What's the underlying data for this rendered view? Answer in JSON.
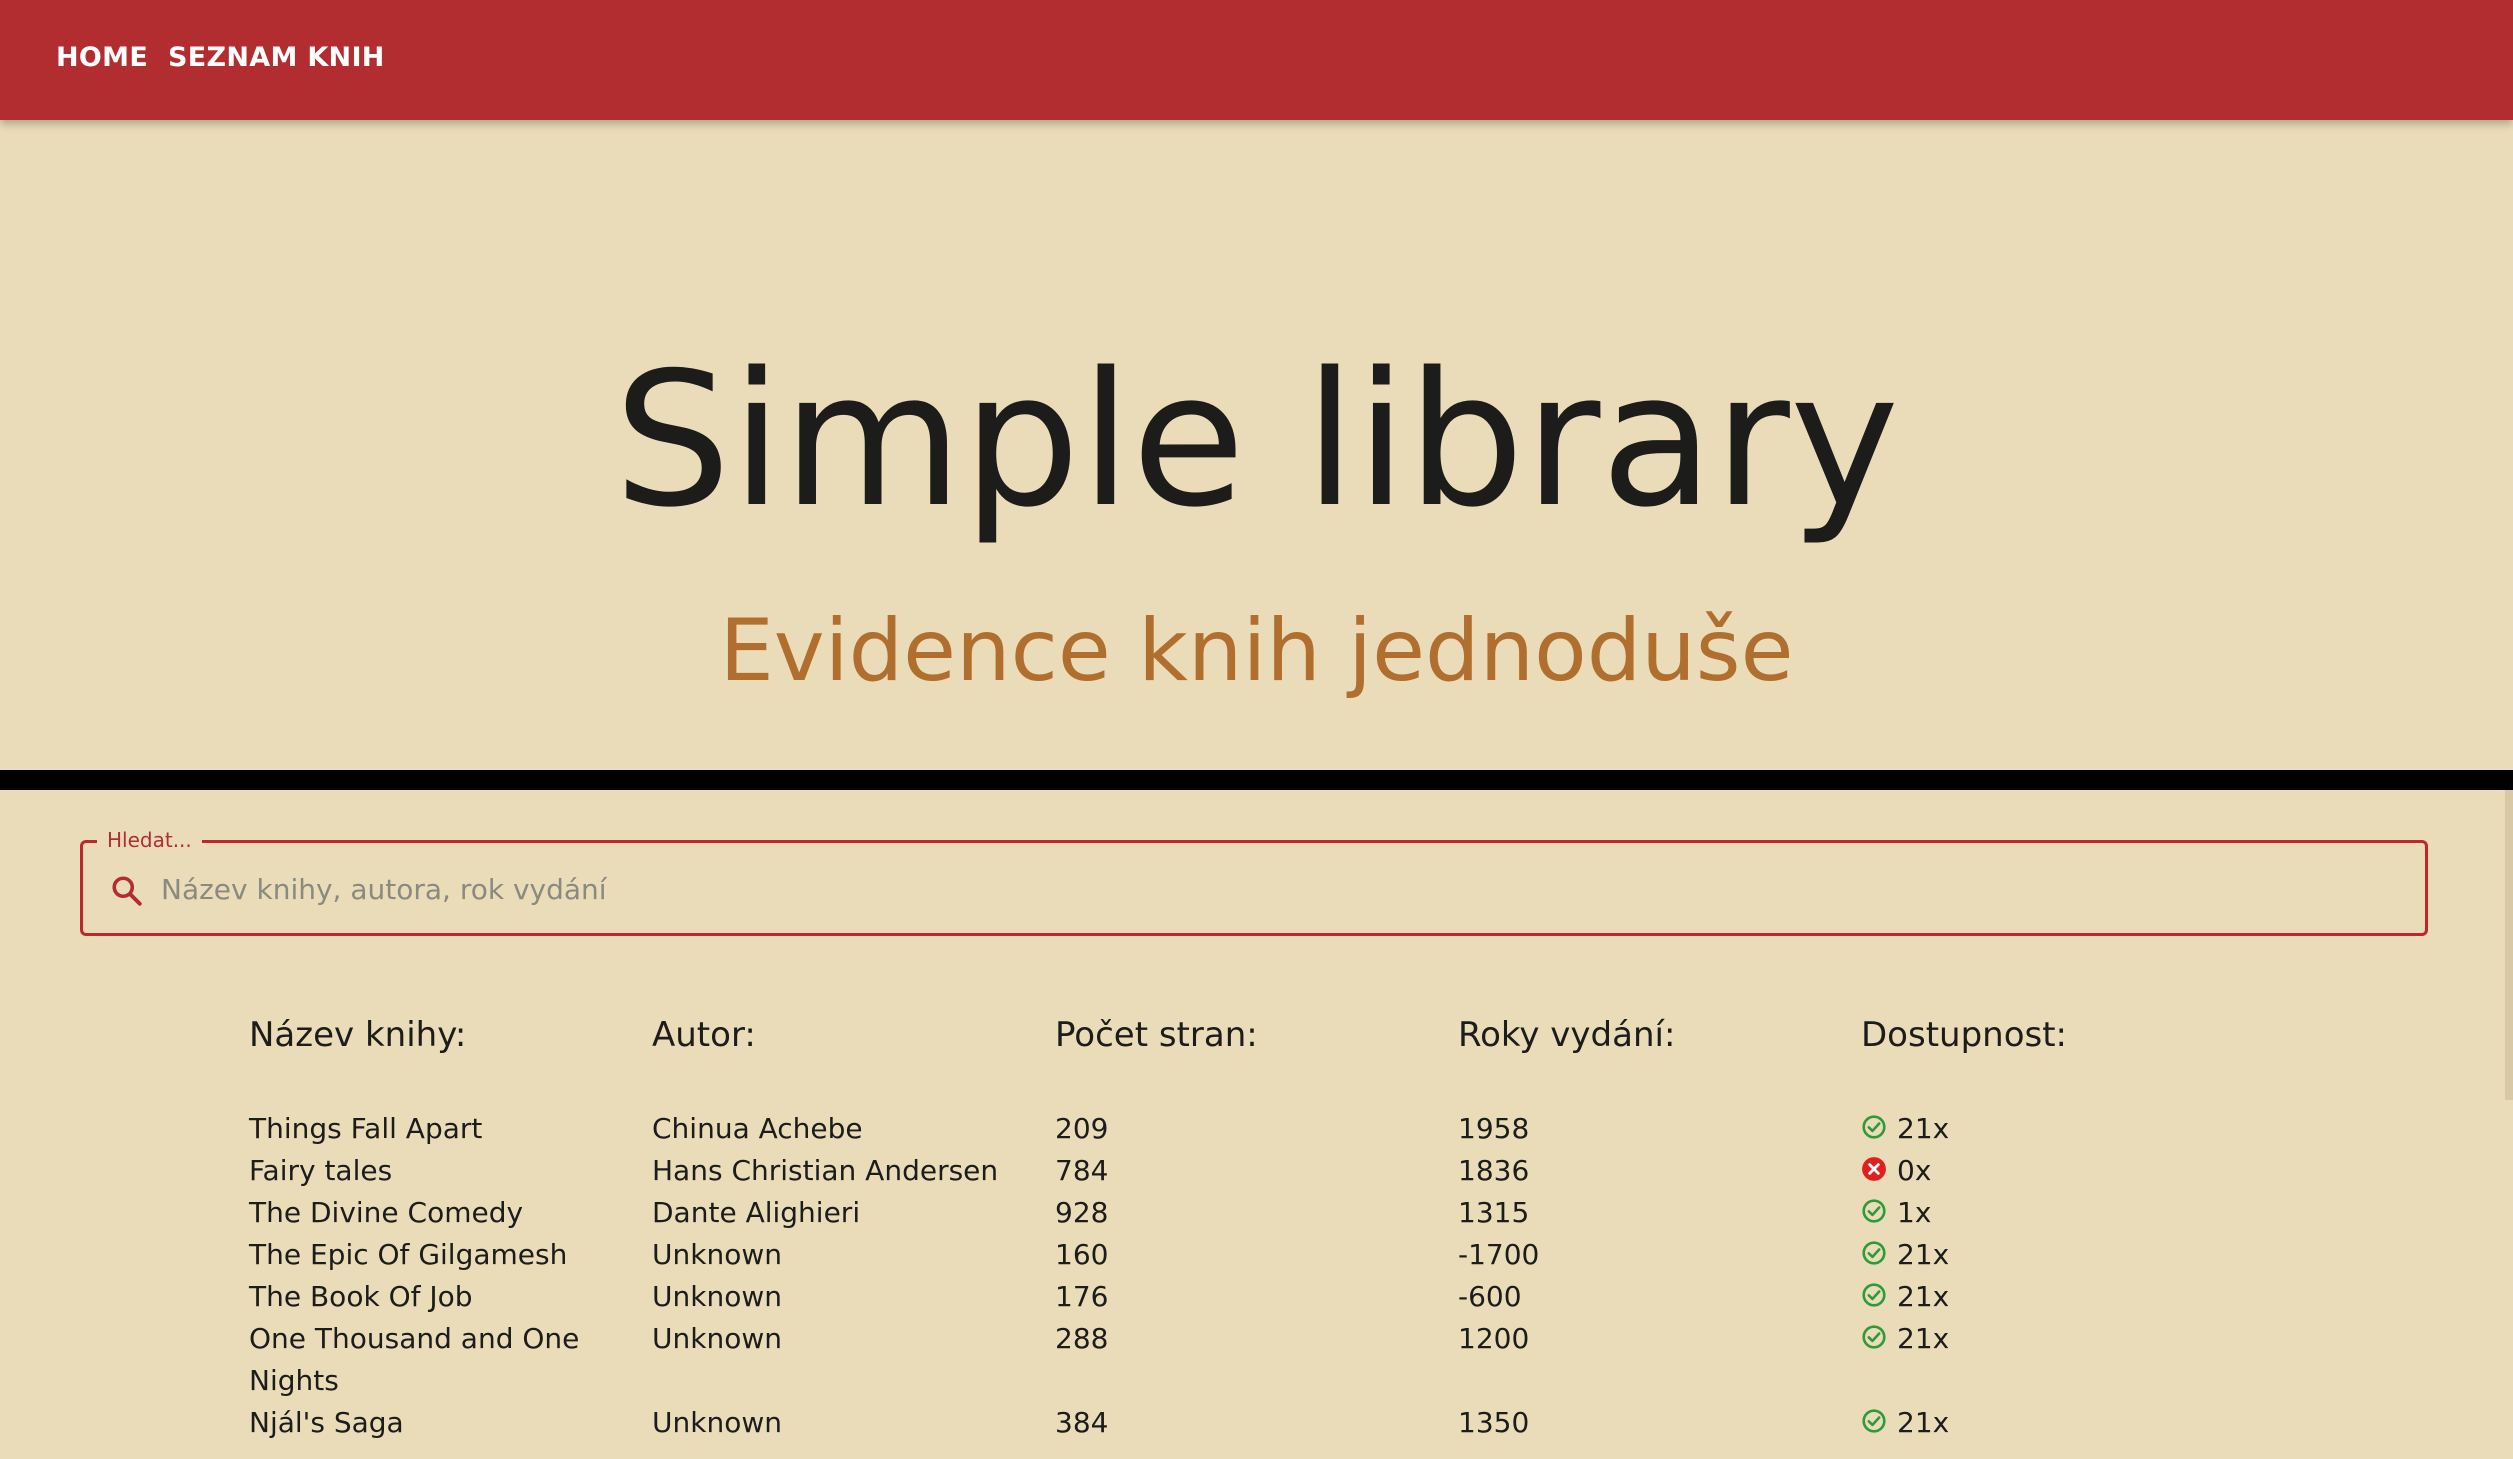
{
  "nav": {
    "home": "HOME",
    "books": "SEZNAM KNIH"
  },
  "hero": {
    "title": "Simple library",
    "subtitle": "Evidence knih jednoduše"
  },
  "search": {
    "legend": "Hledat...",
    "placeholder": "Název knihy, autora, rok vydání",
    "value": ""
  },
  "table": {
    "headers": {
      "title": "Název knihy:",
      "author": "Autor:",
      "pages": "Počet stran:",
      "year": "Roky vydání:",
      "availability": "Dostupnost:"
    },
    "rows": [
      {
        "title": "Things Fall Apart",
        "author": "Chinua Achebe",
        "pages": "209",
        "year": "1958",
        "availability": "21x",
        "status": "available"
      },
      {
        "title": "Fairy tales",
        "author": "Hans Christian Andersen",
        "pages": "784",
        "year": "1836",
        "availability": "0x",
        "status": "unavailable"
      },
      {
        "title": "The Divine Comedy",
        "author": "Dante Alighieri",
        "pages": "928",
        "year": "1315",
        "availability": "1x",
        "status": "available"
      },
      {
        "title": "The Epic Of Gilgamesh",
        "author": "Unknown",
        "pages": "160",
        "year": "-1700",
        "availability": "21x",
        "status": "available"
      },
      {
        "title": "The Book Of Job",
        "author": "Unknown",
        "pages": "176",
        "year": "-600",
        "availability": "21x",
        "status": "available"
      },
      {
        "title": "One Thousand and One Nights",
        "author": "Unknown",
        "pages": "288",
        "year": "1200",
        "availability": "21x",
        "status": "available"
      },
      {
        "title": "Njál's Saga",
        "author": "Unknown",
        "pages": "384",
        "year": "1350",
        "availability": "21x",
        "status": "available"
      }
    ]
  },
  "colors": {
    "appbar": "#b12d30",
    "background": "#ebdcb9",
    "subtitle": "#b06f2e",
    "available": "#2e9a3a",
    "unavailable": "#e0201e"
  },
  "icons": {
    "search": "search-icon",
    "available": "check-circle-icon",
    "unavailable": "close-circle-icon"
  }
}
